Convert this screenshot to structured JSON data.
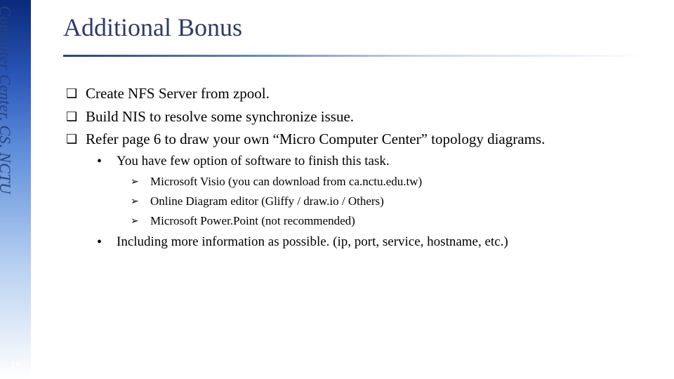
{
  "sidebar": {
    "org_text": "Computer Center, CS, NCTU",
    "page_number": "18"
  },
  "title": "Additional Bonus",
  "bullets": {
    "b1": "Create NFS Server from zpool.",
    "b2": "Build NIS to resolve some synchronize issue.",
    "b3": "Refer page 6 to draw your own “Micro Computer Center” topology diagrams.",
    "b3_1": "You have few option of software to finish this task.",
    "b3_1_1": "Microsoft Visio (you can download from ca.nctu.edu.tw)",
    "b3_1_2": "Online Diagram editor (Gliffy / draw.io / Others)",
    "b3_1_3": "Microsoft Power.Point (not recommended)",
    "b3_2": "Including more information as possible. (ip, port, service, hostname, etc.)"
  }
}
